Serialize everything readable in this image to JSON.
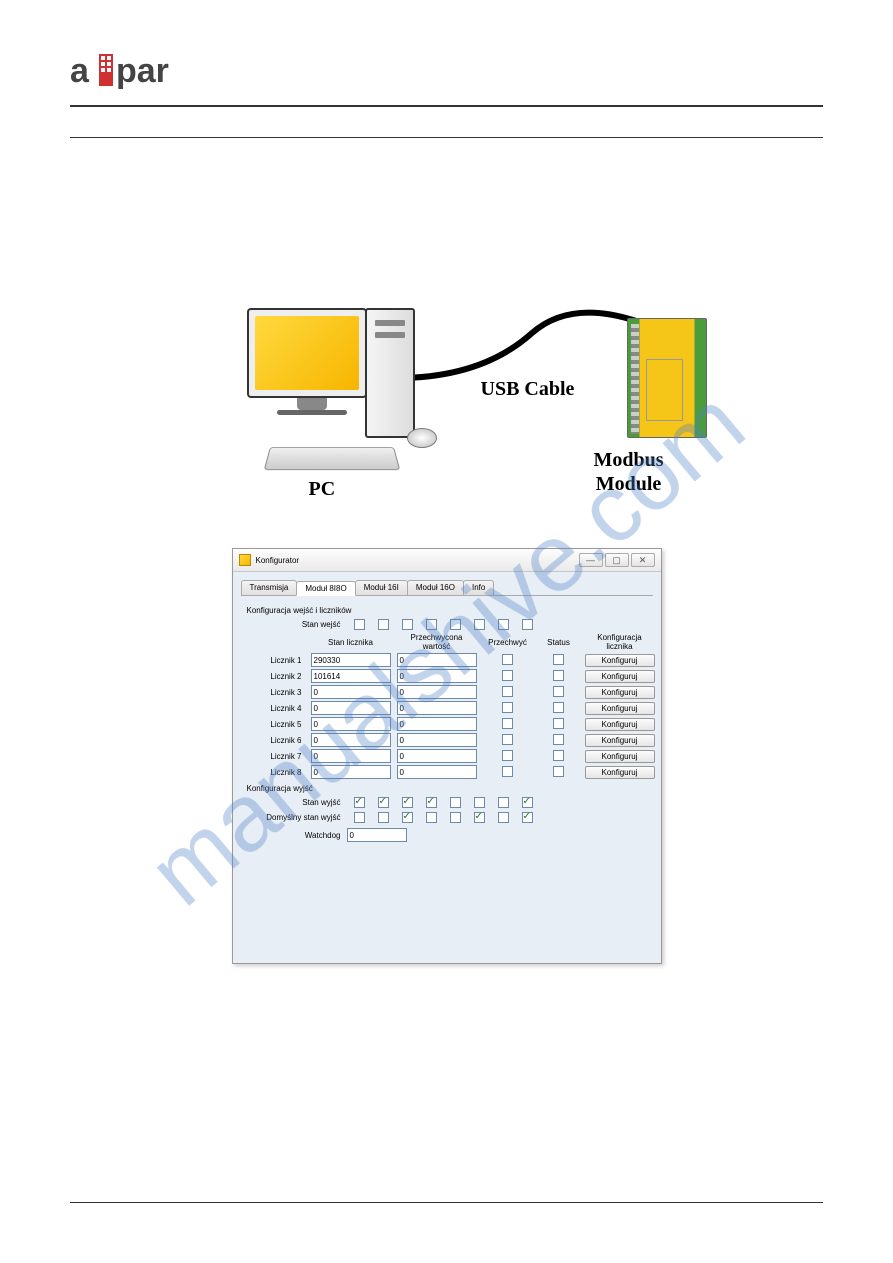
{
  "watermark": "manualshive.com",
  "diagram": {
    "pc_label": "PC",
    "usb_label": "USB Cable",
    "module_label_line1": "Modbus",
    "module_label_line2": "Module"
  },
  "window": {
    "title": "Konfigurator",
    "tabs": [
      {
        "label": "Transmisja"
      },
      {
        "label": "Moduł 8I8O"
      },
      {
        "label": "Moduł 16I"
      },
      {
        "label": "Moduł 16O"
      },
      {
        "label": "Info"
      }
    ],
    "section_inputs": "Konfiguracja wejść i liczników",
    "stan_wejsc_label": "Stan wejść",
    "stan_wejsc": [
      false,
      false,
      false,
      false,
      false,
      false,
      false,
      false
    ],
    "headers": {
      "stan_licznika": "Stan licznika",
      "przechwycona": "Przechwycona wartość",
      "przechwyc": "Przechwyć",
      "status": "Status",
      "konfig": "Konfiguracja licznika"
    },
    "counters": [
      {
        "label": "Licznik 1",
        "stan": "290330",
        "captured": "0",
        "capture": false,
        "status": false,
        "btn": "Konfiguruj"
      },
      {
        "label": "Licznik 2",
        "stan": "101614",
        "captured": "0",
        "capture": false,
        "status": false,
        "btn": "Konfiguruj"
      },
      {
        "label": "Licznik 3",
        "stan": "0",
        "captured": "0",
        "capture": false,
        "status": false,
        "btn": "Konfiguruj"
      },
      {
        "label": "Licznik 4",
        "stan": "0",
        "captured": "0",
        "capture": false,
        "status": false,
        "btn": "Konfiguruj"
      },
      {
        "label": "Licznik 5",
        "stan": "0",
        "captured": "0",
        "capture": false,
        "status": false,
        "btn": "Konfiguruj"
      },
      {
        "label": "Licznik 6",
        "stan": "0",
        "captured": "0",
        "capture": false,
        "status": false,
        "btn": "Konfiguruj"
      },
      {
        "label": "Licznik 7",
        "stan": "0",
        "captured": "0",
        "capture": false,
        "status": false,
        "btn": "Konfiguruj"
      },
      {
        "label": "Licznik 8",
        "stan": "0",
        "captured": "0",
        "capture": false,
        "status": false,
        "btn": "Konfiguruj"
      }
    ],
    "section_outputs": "Konfiguracja wyjść",
    "stan_wyjsc_label": "Stan wyjść",
    "stan_wyjsc": [
      true,
      true,
      true,
      true,
      false,
      false,
      false,
      true
    ],
    "dom_stan_label": "Domyślny stan wyjść",
    "dom_stan": [
      false,
      false,
      true,
      false,
      false,
      true,
      false,
      true
    ],
    "watchdog_label": "Watchdog",
    "watchdog_value": "0"
  }
}
